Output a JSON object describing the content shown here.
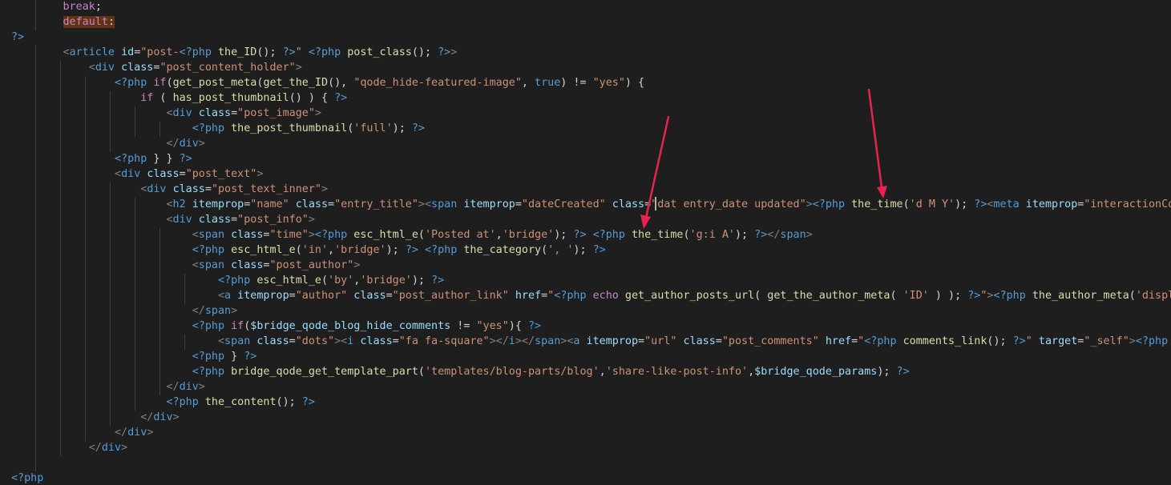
{
  "colors": {
    "background": "#1e1e1e",
    "default_text": "#d4d4d4",
    "keyword_control": "#c586c0",
    "php_tag": "#569cd6",
    "html_tag": "#569cd6",
    "html_bracket": "#808080",
    "attribute": "#9cdcfe",
    "string": "#ce9178",
    "function": "#dcdcaa",
    "indent_guide": "#404040",
    "arrow": "#e8244e",
    "selection_highlight": "#613214"
  },
  "code_lines": [
    [
      {
        "t": "        "
      },
      {
        "t": "break",
        "c": "kw"
      },
      {
        "t": ";"
      }
    ],
    [
      {
        "t": "        "
      },
      {
        "t": "default",
        "c": "kw",
        "hl": true
      },
      {
        "t": ":",
        "hl": true
      }
    ],
    [
      {
        "t": "?>",
        "c": "tag"
      }
    ],
    [
      {
        "t": "        "
      },
      {
        "t": "<",
        "c": "br"
      },
      {
        "t": "article",
        "c": "tag"
      },
      {
        "t": " "
      },
      {
        "t": "id",
        "c": "attr"
      },
      {
        "t": "="
      },
      {
        "t": "\"post-",
        "c": "str"
      },
      {
        "t": "<?php",
        "c": "tag"
      },
      {
        "t": " "
      },
      {
        "t": "the_ID",
        "c": "fn"
      },
      {
        "t": "(); "
      },
      {
        "t": "?>",
        "c": "tag"
      },
      {
        "t": "\"",
        "c": "str"
      },
      {
        "t": " "
      },
      {
        "t": "<?php",
        "c": "tag"
      },
      {
        "t": " "
      },
      {
        "t": "post_class",
        "c": "fn"
      },
      {
        "t": "(); "
      },
      {
        "t": "?>",
        "c": "tag"
      },
      {
        "t": ">",
        "c": "br"
      }
    ],
    [
      {
        "t": "            "
      },
      {
        "t": "<",
        "c": "br"
      },
      {
        "t": "div",
        "c": "tag"
      },
      {
        "t": " "
      },
      {
        "t": "class",
        "c": "attr"
      },
      {
        "t": "="
      },
      {
        "t": "\"post_content_holder\"",
        "c": "str"
      },
      {
        "t": ">",
        "c": "br"
      }
    ],
    [
      {
        "t": "                "
      },
      {
        "t": "<?php",
        "c": "tag"
      },
      {
        "t": " "
      },
      {
        "t": "if",
        "c": "kw"
      },
      {
        "t": "("
      },
      {
        "t": "get_post_meta",
        "c": "fn"
      },
      {
        "t": "("
      },
      {
        "t": "get_the_ID",
        "c": "fn"
      },
      {
        "t": "(), "
      },
      {
        "t": "\"qode_hide-featured-image\"",
        "c": "str"
      },
      {
        "t": ", "
      },
      {
        "t": "true",
        "c": "tag"
      },
      {
        "t": ") != "
      },
      {
        "t": "\"yes\"",
        "c": "str"
      },
      {
        "t": ") {"
      }
    ],
    [
      {
        "t": "                    "
      },
      {
        "t": "if",
        "c": "kw"
      },
      {
        "t": " ( "
      },
      {
        "t": "has_post_thumbnail",
        "c": "fn"
      },
      {
        "t": "() ) { "
      },
      {
        "t": "?>",
        "c": "tag"
      }
    ],
    [
      {
        "t": "                        "
      },
      {
        "t": "<",
        "c": "br"
      },
      {
        "t": "div",
        "c": "tag"
      },
      {
        "t": " "
      },
      {
        "t": "class",
        "c": "attr"
      },
      {
        "t": "="
      },
      {
        "t": "\"post_image\"",
        "c": "str"
      },
      {
        "t": ">",
        "c": "br"
      }
    ],
    [
      {
        "t": "                            "
      },
      {
        "t": "<?php",
        "c": "tag"
      },
      {
        "t": " "
      },
      {
        "t": "the_post_thumbnail",
        "c": "fn"
      },
      {
        "t": "("
      },
      {
        "t": "'full'",
        "c": "str"
      },
      {
        "t": "); "
      },
      {
        "t": "?>",
        "c": "tag"
      }
    ],
    [
      {
        "t": "                        "
      },
      {
        "t": "</",
        "c": "br"
      },
      {
        "t": "div",
        "c": "tag"
      },
      {
        "t": ">",
        "c": "br"
      }
    ],
    [
      {
        "t": "                "
      },
      {
        "t": "<?php",
        "c": "tag"
      },
      {
        "t": " } } "
      },
      {
        "t": "?>",
        "c": "tag"
      }
    ],
    [
      {
        "t": "                "
      },
      {
        "t": "<",
        "c": "br"
      },
      {
        "t": "div",
        "c": "tag"
      },
      {
        "t": " "
      },
      {
        "t": "class",
        "c": "attr"
      },
      {
        "t": "="
      },
      {
        "t": "\"post_text\"",
        "c": "str"
      },
      {
        "t": ">",
        "c": "br"
      }
    ],
    [
      {
        "t": "                    "
      },
      {
        "t": "<",
        "c": "br"
      },
      {
        "t": "div",
        "c": "tag"
      },
      {
        "t": " "
      },
      {
        "t": "class",
        "c": "attr"
      },
      {
        "t": "="
      },
      {
        "t": "\"post_text_inner\"",
        "c": "str"
      },
      {
        "t": ">",
        "c": "br"
      }
    ],
    [
      {
        "t": "                        "
      },
      {
        "t": "<",
        "c": "br"
      },
      {
        "t": "h2",
        "c": "tag"
      },
      {
        "t": " "
      },
      {
        "t": "itemprop",
        "c": "attr"
      },
      {
        "t": "="
      },
      {
        "t": "\"name\"",
        "c": "str"
      },
      {
        "t": " "
      },
      {
        "t": "class",
        "c": "attr"
      },
      {
        "t": "="
      },
      {
        "t": "\"entry_title\"",
        "c": "str"
      },
      {
        "t": ">",
        "c": "br"
      },
      {
        "t": "<",
        "c": "br"
      },
      {
        "t": "span",
        "c": "tag"
      },
      {
        "t": " "
      },
      {
        "t": "itemprop",
        "c": "attr"
      },
      {
        "t": "="
      },
      {
        "t": "\"dateCreated\"",
        "c": "str"
      },
      {
        "t": " "
      },
      {
        "t": "class",
        "c": "attr"
      },
      {
        "t": "="
      },
      {
        "t": "\"dat",
        "c": "str"
      },
      {
        "t": " "
      },
      {
        "t": "entry_date updated\"",
        "c": "str"
      },
      {
        "t": ">",
        "c": "br"
      },
      {
        "t": "<?php",
        "c": "tag"
      },
      {
        "t": " "
      },
      {
        "t": "the_time",
        "c": "fn"
      },
      {
        "t": "("
      },
      {
        "t": "'d M Y'",
        "c": "str"
      },
      {
        "t": "); "
      },
      {
        "t": "?>",
        "c": "tag"
      },
      {
        "t": "<",
        "c": "br"
      },
      {
        "t": "meta",
        "c": "tag"
      },
      {
        "t": " "
      },
      {
        "t": "itemprop",
        "c": "attr"
      },
      {
        "t": "="
      },
      {
        "t": "\"interactionCount\"",
        "c": "str"
      },
      {
        "t": " "
      },
      {
        "t": "co",
        "c": "attr"
      }
    ],
    [
      {
        "t": "                        "
      },
      {
        "t": "<",
        "c": "br"
      },
      {
        "t": "div",
        "c": "tag"
      },
      {
        "t": " "
      },
      {
        "t": "class",
        "c": "attr"
      },
      {
        "t": "="
      },
      {
        "t": "\"post_info\"",
        "c": "str"
      },
      {
        "t": ">",
        "c": "br"
      }
    ],
    [
      {
        "t": "                            "
      },
      {
        "t": "<",
        "c": "br"
      },
      {
        "t": "span",
        "c": "tag"
      },
      {
        "t": " "
      },
      {
        "t": "class",
        "c": "attr"
      },
      {
        "t": "="
      },
      {
        "t": "\"time\"",
        "c": "str"
      },
      {
        "t": ">",
        "c": "br"
      },
      {
        "t": "<?php",
        "c": "tag"
      },
      {
        "t": " "
      },
      {
        "t": "esc_html_e",
        "c": "fn"
      },
      {
        "t": "("
      },
      {
        "t": "'Posted at'",
        "c": "str"
      },
      {
        "t": ","
      },
      {
        "t": "'bridge'",
        "c": "str"
      },
      {
        "t": "); "
      },
      {
        "t": "?>",
        "c": "tag"
      },
      {
        "t": " "
      },
      {
        "t": "<?php",
        "c": "tag"
      },
      {
        "t": " "
      },
      {
        "t": "the_time",
        "c": "fn"
      },
      {
        "t": "("
      },
      {
        "t": "'g:i A'",
        "c": "str"
      },
      {
        "t": "); "
      },
      {
        "t": "?>",
        "c": "tag"
      },
      {
        "t": "</",
        "c": "br"
      },
      {
        "t": "span",
        "c": "tag"
      },
      {
        "t": ">",
        "c": "br"
      }
    ],
    [
      {
        "t": "                            "
      },
      {
        "t": "<?php",
        "c": "tag"
      },
      {
        "t": " "
      },
      {
        "t": "esc_html_e",
        "c": "fn"
      },
      {
        "t": "("
      },
      {
        "t": "'in'",
        "c": "str"
      },
      {
        "t": ","
      },
      {
        "t": "'bridge'",
        "c": "str"
      },
      {
        "t": "); "
      },
      {
        "t": "?>",
        "c": "tag"
      },
      {
        "t": " "
      },
      {
        "t": "<?php",
        "c": "tag"
      },
      {
        "t": " "
      },
      {
        "t": "the_category",
        "c": "fn"
      },
      {
        "t": "("
      },
      {
        "t": "', '",
        "c": "str"
      },
      {
        "t": "); "
      },
      {
        "t": "?>",
        "c": "tag"
      }
    ],
    [
      {
        "t": "                            "
      },
      {
        "t": "<",
        "c": "br"
      },
      {
        "t": "span",
        "c": "tag"
      },
      {
        "t": " "
      },
      {
        "t": "class",
        "c": "attr"
      },
      {
        "t": "="
      },
      {
        "t": "\"post_author\"",
        "c": "str"
      },
      {
        "t": ">",
        "c": "br"
      }
    ],
    [
      {
        "t": "                                "
      },
      {
        "t": "<?php",
        "c": "tag"
      },
      {
        "t": " "
      },
      {
        "t": "esc_html_e",
        "c": "fn"
      },
      {
        "t": "("
      },
      {
        "t": "'by'",
        "c": "str"
      },
      {
        "t": ","
      },
      {
        "t": "'bridge'",
        "c": "str"
      },
      {
        "t": "); "
      },
      {
        "t": "?>",
        "c": "tag"
      }
    ],
    [
      {
        "t": "                                "
      },
      {
        "t": "<",
        "c": "br"
      },
      {
        "t": "a",
        "c": "tag"
      },
      {
        "t": " "
      },
      {
        "t": "itemprop",
        "c": "attr"
      },
      {
        "t": "="
      },
      {
        "t": "\"author\"",
        "c": "str"
      },
      {
        "t": " "
      },
      {
        "t": "class",
        "c": "attr"
      },
      {
        "t": "="
      },
      {
        "t": "\"post_author_link\"",
        "c": "str"
      },
      {
        "t": " "
      },
      {
        "t": "href",
        "c": "attr"
      },
      {
        "t": "="
      },
      {
        "t": "\"",
        "c": "str"
      },
      {
        "t": "<?php",
        "c": "tag"
      },
      {
        "t": " "
      },
      {
        "t": "echo",
        "c": "kw"
      },
      {
        "t": " "
      },
      {
        "t": "get_author_posts_url",
        "c": "fn"
      },
      {
        "t": "( "
      },
      {
        "t": "get_the_author_meta",
        "c": "fn"
      },
      {
        "t": "( "
      },
      {
        "t": "'ID'",
        "c": "str"
      },
      {
        "t": " ) ); "
      },
      {
        "t": "?>",
        "c": "tag"
      },
      {
        "t": "\"",
        "c": "str"
      },
      {
        "t": ">",
        "c": "br"
      },
      {
        "t": "<?php",
        "c": "tag"
      },
      {
        "t": " "
      },
      {
        "t": "the_author_meta",
        "c": "fn"
      },
      {
        "t": "("
      },
      {
        "t": "'display_name'",
        "c": "str"
      }
    ],
    [
      {
        "t": "                            "
      },
      {
        "t": "</",
        "c": "br"
      },
      {
        "t": "span",
        "c": "tag"
      },
      {
        "t": ">",
        "c": "br"
      }
    ],
    [
      {
        "t": "                            "
      },
      {
        "t": "<?php",
        "c": "tag"
      },
      {
        "t": " "
      },
      {
        "t": "if",
        "c": "kw"
      },
      {
        "t": "("
      },
      {
        "t": "$bridge_qode_blog_hide_comments",
        "c": "attr"
      },
      {
        "t": " != "
      },
      {
        "t": "\"yes\"",
        "c": "str"
      },
      {
        "t": "){ "
      },
      {
        "t": "?>",
        "c": "tag"
      }
    ],
    [
      {
        "t": "                                "
      },
      {
        "t": "<",
        "c": "br"
      },
      {
        "t": "span",
        "c": "tag"
      },
      {
        "t": " "
      },
      {
        "t": "class",
        "c": "attr"
      },
      {
        "t": "="
      },
      {
        "t": "\"dots\"",
        "c": "str"
      },
      {
        "t": ">",
        "c": "br"
      },
      {
        "t": "<",
        "c": "br"
      },
      {
        "t": "i",
        "c": "tag"
      },
      {
        "t": " "
      },
      {
        "t": "class",
        "c": "attr"
      },
      {
        "t": "="
      },
      {
        "t": "\"fa fa-square\"",
        "c": "str"
      },
      {
        "t": ">",
        "c": "br"
      },
      {
        "t": "</",
        "c": "br"
      },
      {
        "t": "i",
        "c": "tag"
      },
      {
        "t": ">",
        "c": "br"
      },
      {
        "t": "</",
        "c": "br"
      },
      {
        "t": "span",
        "c": "tag"
      },
      {
        "t": ">",
        "c": "br"
      },
      {
        "t": "<",
        "c": "br"
      },
      {
        "t": "a",
        "c": "tag"
      },
      {
        "t": " "
      },
      {
        "t": "itemprop",
        "c": "attr"
      },
      {
        "t": "="
      },
      {
        "t": "\"url\"",
        "c": "str"
      },
      {
        "t": " "
      },
      {
        "t": "class",
        "c": "attr"
      },
      {
        "t": "="
      },
      {
        "t": "\"post_comments\"",
        "c": "str"
      },
      {
        "t": " "
      },
      {
        "t": "href",
        "c": "attr"
      },
      {
        "t": "="
      },
      {
        "t": "\"",
        "c": "str"
      },
      {
        "t": "<?php",
        "c": "tag"
      },
      {
        "t": " "
      },
      {
        "t": "comments_link",
        "c": "fn"
      },
      {
        "t": "(); "
      },
      {
        "t": "?>",
        "c": "tag"
      },
      {
        "t": "\"",
        "c": "str"
      },
      {
        "t": " "
      },
      {
        "t": "target",
        "c": "attr"
      },
      {
        "t": "="
      },
      {
        "t": "\"_self\"",
        "c": "str"
      },
      {
        "t": ">",
        "c": "br"
      },
      {
        "t": "<?php",
        "c": "tag"
      },
      {
        "t": " "
      },
      {
        "t": "comments_",
        "c": "fn"
      }
    ],
    [
      {
        "t": "                            "
      },
      {
        "t": "<?php",
        "c": "tag"
      },
      {
        "t": " } "
      },
      {
        "t": "?>",
        "c": "tag"
      }
    ],
    [
      {
        "t": "                            "
      },
      {
        "t": "<?php",
        "c": "tag"
      },
      {
        "t": " "
      },
      {
        "t": "bridge_qode_get_template_part",
        "c": "fn"
      },
      {
        "t": "("
      },
      {
        "t": "'templates/blog-parts/blog'",
        "c": "str"
      },
      {
        "t": ","
      },
      {
        "t": "'share-like-post-info'",
        "c": "str"
      },
      {
        "t": ","
      },
      {
        "t": "$bridge_qode_params",
        "c": "attr"
      },
      {
        "t": "); "
      },
      {
        "t": "?>",
        "c": "tag"
      }
    ],
    [
      {
        "t": "                        "
      },
      {
        "t": "</",
        "c": "br"
      },
      {
        "t": "div",
        "c": "tag"
      },
      {
        "t": ">",
        "c": "br"
      }
    ],
    [
      {
        "t": "                        "
      },
      {
        "t": "<?php",
        "c": "tag"
      },
      {
        "t": " "
      },
      {
        "t": "the_content",
        "c": "fn"
      },
      {
        "t": "(); "
      },
      {
        "t": "?>",
        "c": "tag"
      }
    ],
    [
      {
        "t": "                    "
      },
      {
        "t": "</",
        "c": "br"
      },
      {
        "t": "div",
        "c": "tag"
      },
      {
        "t": ">",
        "c": "br"
      }
    ],
    [
      {
        "t": "                "
      },
      {
        "t": "</",
        "c": "br"
      },
      {
        "t": "div",
        "c": "tag"
      },
      {
        "t": ">",
        "c": "br"
      }
    ],
    [
      {
        "t": "            "
      },
      {
        "t": "</",
        "c": "br"
      },
      {
        "t": "div",
        "c": "tag"
      },
      {
        "t": ">",
        "c": "br"
      }
    ],
    [],
    [
      {
        "t": "<?php",
        "c": "tag"
      }
    ]
  ]
}
